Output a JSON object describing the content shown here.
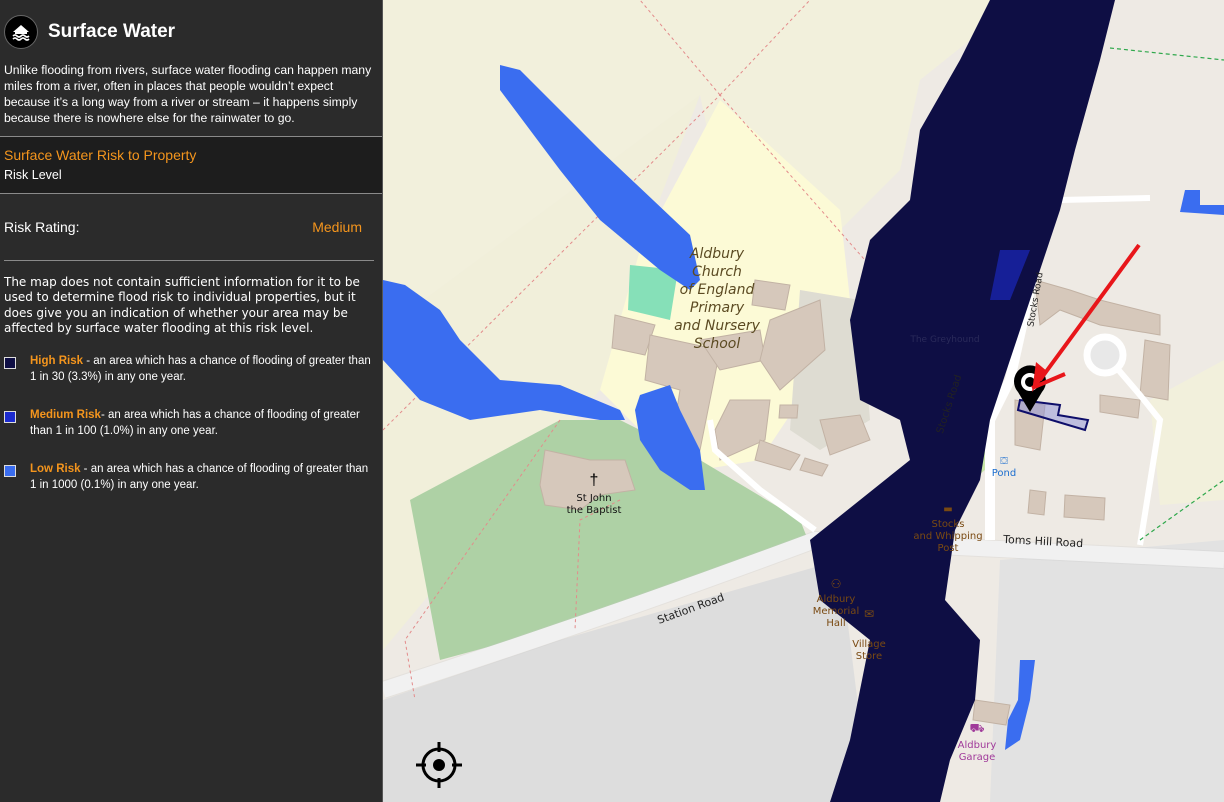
{
  "panel": {
    "title": "Surface Water",
    "icon": "house-water-icon",
    "intro": "Unlike flooding from rivers, surface water flooding can happen many miles from a river, often in places that people wouldn’t expect because it’s a long way from a river or stream – it happens simply because there is nowhere else for the rainwater to go.",
    "section_title": "Surface Water Risk to Property",
    "section_sub": "Risk Level",
    "rating_label": "Risk Rating:",
    "rating_value": "Medium",
    "note": "The map does not contain sufficient information for it to be used to determine flood risk to individual properties, but it does give you an indication of whether your area may be affected by surface water flooding at this risk level.",
    "legend": [
      {
        "key": "High Risk",
        "text": " - an area which has a chance of flooding of greater than 1 in 30 (3.3%) in any one year.",
        "color": "#0e0e44"
      },
      {
        "key": "Medium Risk",
        "text": "- an area which has a chance of flooding of greater than 1 in 100 (1.0%) in any one year.",
        "color": "#1c2bcf"
      },
      {
        "key": "Low Risk",
        "text": " - an area which has a chance of flooding of greater than 1 in 1000 (0.1%) in any one year.",
        "color": "#3a6df0"
      }
    ]
  },
  "map": {
    "labels": {
      "school": [
        "Aldbury",
        "Church",
        "of England",
        "Primary",
        "and Nursery",
        "School"
      ],
      "church": [
        "St John",
        "the Baptist"
      ],
      "station_road": "Station Road",
      "stocks_road": "Stocks Road",
      "toms_hill_road": "Toms Hill Road",
      "stocks_post": [
        "Stocks",
        "and Whipping",
        "Post"
      ],
      "memorial_hall": [
        "Aldbury",
        "Memorial",
        "Hall"
      ],
      "village_store": [
        "Village",
        "Store"
      ],
      "pond": "Pond",
      "garage": [
        "Aldbury",
        "Garage"
      ],
      "greyhound": "The Greyhound"
    },
    "colors": {
      "high": "#0e0e44",
      "medium": "#1c2bcf",
      "low": "#3a6df0",
      "marker_arrow": "#e8161a"
    }
  },
  "controls": {
    "locate_icon": "crosshair-locate-icon"
  }
}
